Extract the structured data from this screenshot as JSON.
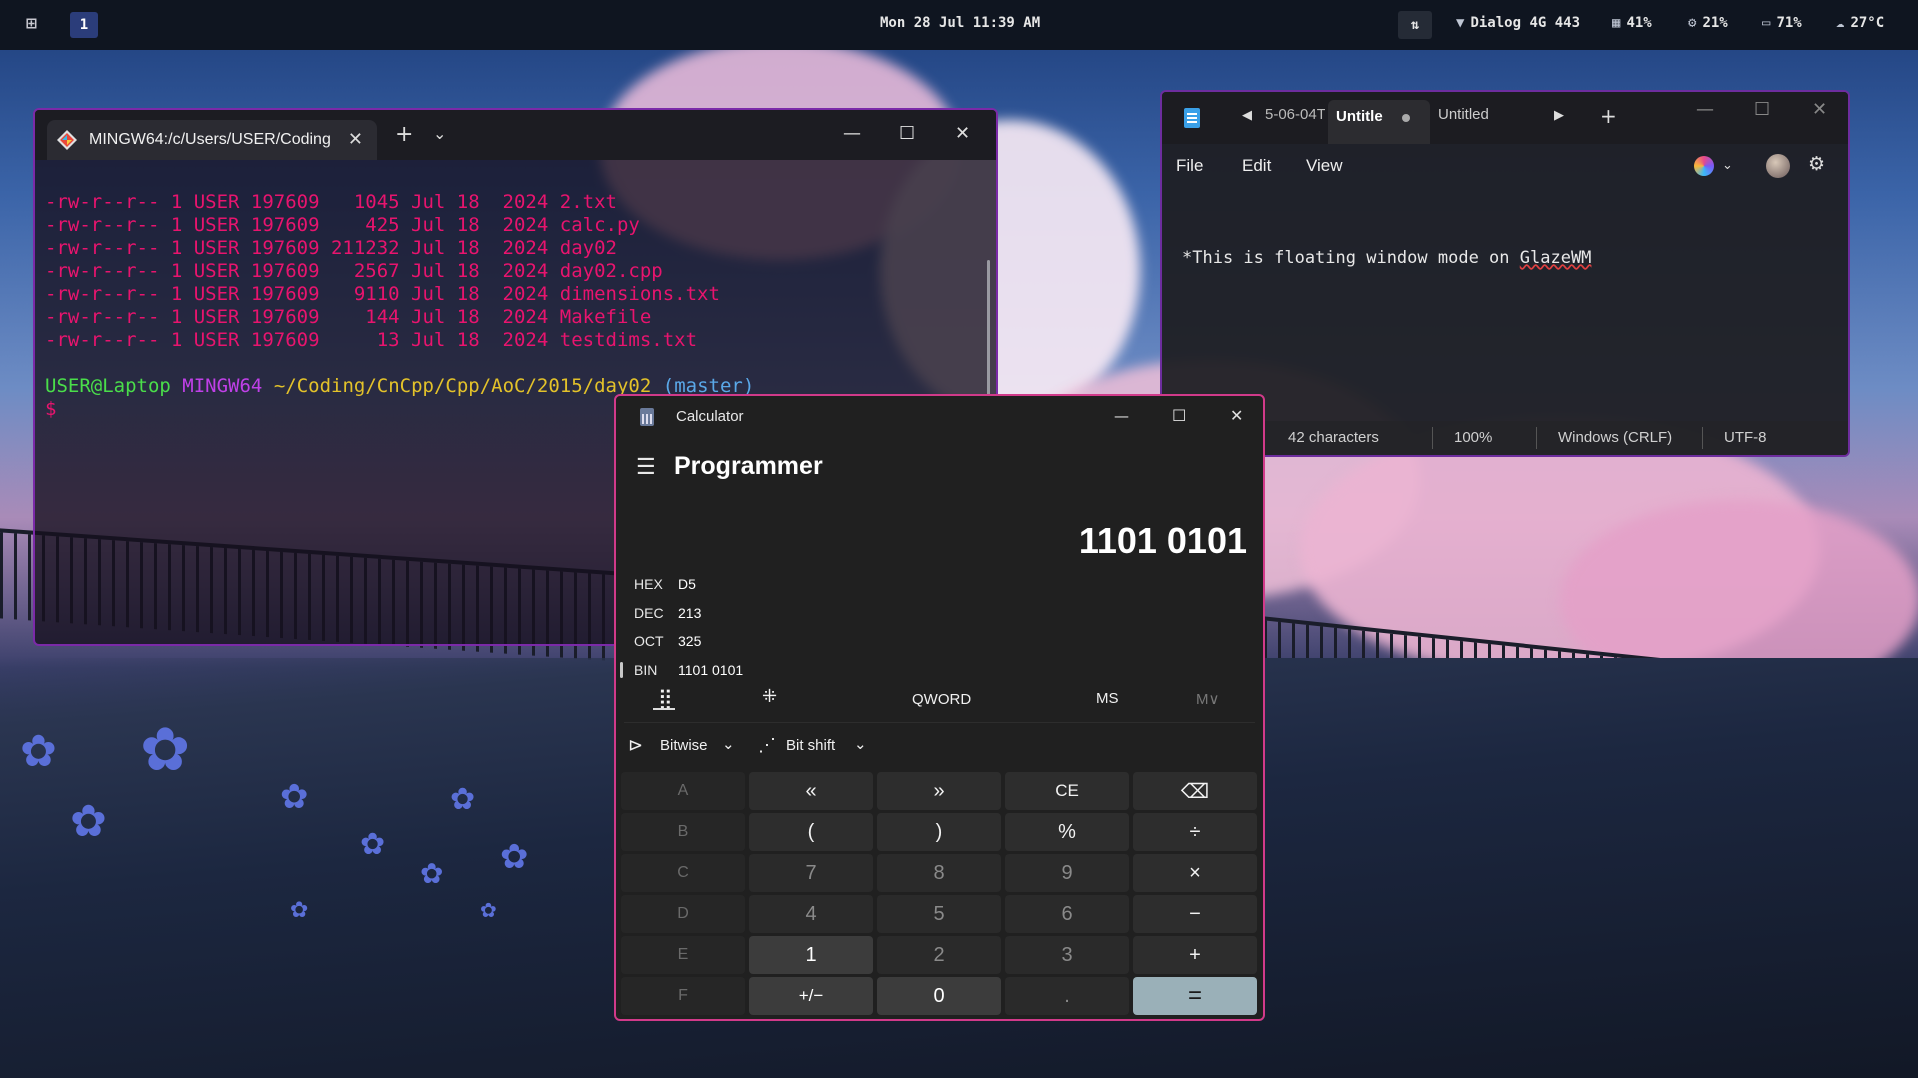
{
  "taskbar": {
    "workspace": "1",
    "clock": "Mon 28 Jul 11:39 AM",
    "network": "Dialog 4G 443",
    "cpu": "41%",
    "memory": "21%",
    "battery": "71%",
    "weather": "27°C"
  },
  "terminal": {
    "tab_title": "MINGW64:/c/Users/USER/Coding",
    "lines": [
      "-rw-r--r-- 1 USER 197609   1045 Jul 18  2024 2.txt",
      "-rw-r--r-- 1 USER 197609    425 Jul 18  2024 calc.py",
      "-rw-r--r-- 1 USER 197609 211232 Jul 18  2024 day02",
      "-rw-r--r-- 1 USER 197609   2567 Jul 18  2024 day02.cpp",
      "-rw-r--r-- 1 USER 197609   9110 Jul 18  2024 dimensions.txt",
      "-rw-r--r-- 1 USER 197609    144 Jul 18  2024 Makefile",
      "-rw-r--r-- 1 USER 197609     13 Jul 18  2024 testdims.txt"
    ],
    "prompt": {
      "user": "USER@Laptop",
      "system": "MINGW64",
      "path": "~/Coding/CnCpp/Cpp/AoC/2015/day02",
      "branch": "(master)",
      "symbol": "$"
    }
  },
  "notepad": {
    "tab_prev": "5-06-04T",
    "tab_active": "Untitle",
    "tab_next": "Untitled",
    "menu": [
      "File",
      "Edit",
      "View"
    ],
    "content_prefix": "*This is floating window mode on ",
    "content_word": "GlazeWM",
    "status": {
      "chars": "42 characters",
      "zoom": "100%",
      "line_ending": "Windows (CRLF)",
      "encoding": "UTF-8"
    }
  },
  "calculator": {
    "title": "Calculator",
    "mode": "Programmer",
    "display": "1101 0101",
    "radix": [
      {
        "label": "HEX",
        "value": "D5"
      },
      {
        "label": "DEC",
        "value": "213"
      },
      {
        "label": "OCT",
        "value": "325"
      },
      {
        "label": "BIN",
        "value": "1101 0101"
      }
    ],
    "word_size": "QWORD",
    "memory_store": "MS",
    "memory_list": "M∨",
    "bitwise": "Bitwise",
    "bitshift": "Bit shift",
    "keys": [
      "A",
      "«",
      "»",
      "CE",
      "⌫",
      "B",
      "(",
      ")",
      "%",
      "÷",
      "C",
      "7",
      "8",
      "9",
      "×",
      "D",
      "4",
      "5",
      "6",
      "−",
      "E",
      "1",
      "2",
      "3",
      "+",
      "F",
      "+/−",
      "0",
      ".",
      "="
    ]
  }
}
